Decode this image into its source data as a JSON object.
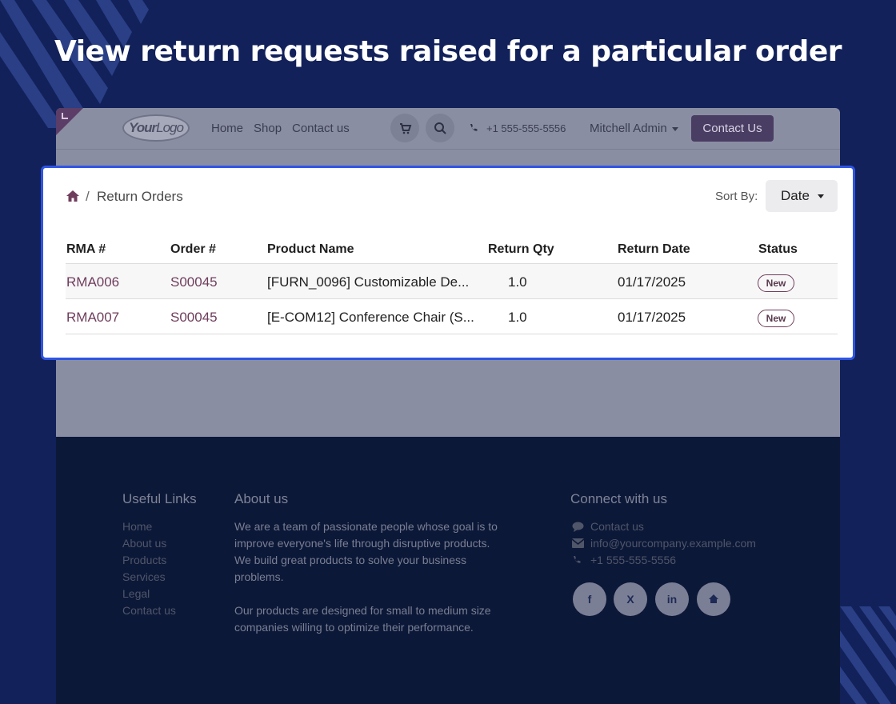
{
  "headline": "View return requests raised for a particular order",
  "navbar": {
    "logo_text": "Your",
    "logo_text_2": "Logo",
    "links": [
      "Home",
      "Shop",
      "Contact us"
    ],
    "phone": "+1 555-555-5556",
    "user": "Mitchell Admin",
    "cta": "Contact Us"
  },
  "portal": {
    "breadcrumb": "Return Orders",
    "sort_label": "Sort By:",
    "sort_value": "Date",
    "columns": [
      "RMA #",
      "Order #",
      "Product Name",
      "Return Qty",
      "Return Date",
      "Status"
    ],
    "rows": [
      {
        "rma": "RMA006",
        "order": "S00045",
        "product": "[FURN_0096] Customizable De...",
        "qty": "1.0",
        "date": "01/17/2025",
        "status": "New"
      },
      {
        "rma": "RMA007",
        "order": "S00045",
        "product": "[E-COM12] Conference Chair (S...",
        "qty": "1.0",
        "date": "01/17/2025",
        "status": "New"
      }
    ]
  },
  "footer": {
    "useful_links_title": "Useful Links",
    "useful_links": [
      "Home",
      "About us",
      "Products",
      "Services",
      "Legal",
      "Contact us"
    ],
    "about_title": "About us",
    "about_p1": "We are a team of passionate people whose goal is to improve everyone's life through disruptive products. We build great products to solve your business problems.",
    "about_p2": "Our products are designed for small to medium size companies willing to optimize their performance.",
    "connect_title": "Connect with us",
    "connect_contact": "Contact us",
    "connect_email": "info@yourcompany.example.com",
    "connect_phone": "+1 555-555-5556",
    "social_labels": [
      "f",
      "X",
      "in"
    ]
  },
  "colors": {
    "page_bg": "#12215a",
    "accent_border": "#2f55e4",
    "link_color": "#6f3d5c",
    "cta_bg": "#4a3d63",
    "footer_bg": "#0c1838"
  }
}
